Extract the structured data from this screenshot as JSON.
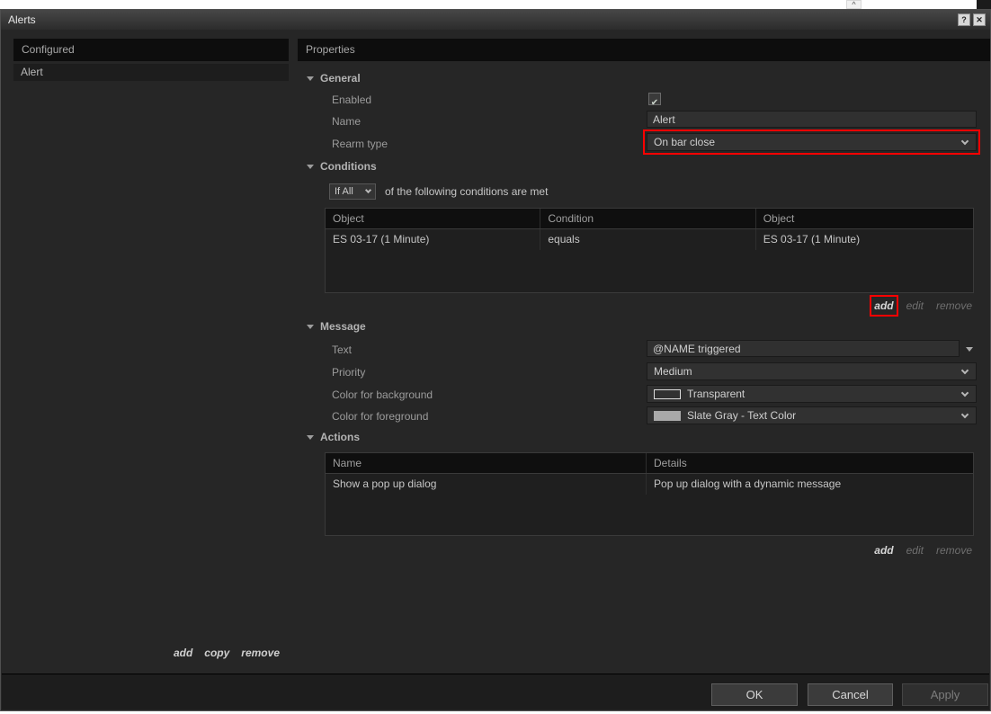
{
  "window": {
    "title": "Alerts",
    "help_label": "?",
    "close_label": "✕"
  },
  "scrollbar": {
    "up_arrow": "^"
  },
  "left_panel": {
    "header": "Configured",
    "items": [
      {
        "label": "Alert"
      }
    ],
    "links": {
      "add": "add",
      "copy": "copy",
      "remove": "remove"
    }
  },
  "properties": {
    "header": "Properties",
    "general": {
      "title": "General",
      "enabled_label": "Enabled",
      "enabled_checked": true,
      "check_glyph": "✔",
      "name_label": "Name",
      "name_value": "Alert",
      "rearm_label": "Rearm type",
      "rearm_value": "On bar close"
    },
    "conditions": {
      "title": "Conditions",
      "match_value": "If All",
      "match_suffix": "of the following conditions are met",
      "columns": [
        "Object",
        "Condition",
        "Object"
      ],
      "rows": [
        [
          "ES 03-17 (1 Minute)",
          "equals",
          "ES 03-17 (1 Minute)"
        ]
      ],
      "links": {
        "add": "add",
        "edit": "edit",
        "remove": "remove"
      }
    },
    "message": {
      "title": "Message",
      "text_label": "Text",
      "text_value": "@NAME triggered",
      "priority_label": "Priority",
      "priority_value": "Medium",
      "background_label": "Color for background",
      "background_value": "Transparent",
      "background_swatch": "transparent",
      "foreground_label": "Color for foreground",
      "foreground_value": "Slate Gray - Text Color",
      "foreground_swatch": "#a9a9a9"
    },
    "actions": {
      "title": "Actions",
      "columns": [
        "Name",
        "Details"
      ],
      "rows": [
        [
          "Show a pop up dialog",
          "Pop up dialog with a dynamic message"
        ]
      ],
      "links": {
        "add": "add",
        "edit": "edit",
        "remove": "remove"
      }
    }
  },
  "footer": {
    "ok": "OK",
    "cancel": "Cancel",
    "apply": "Apply"
  },
  "annotation": {
    "color": "#ff0000"
  }
}
